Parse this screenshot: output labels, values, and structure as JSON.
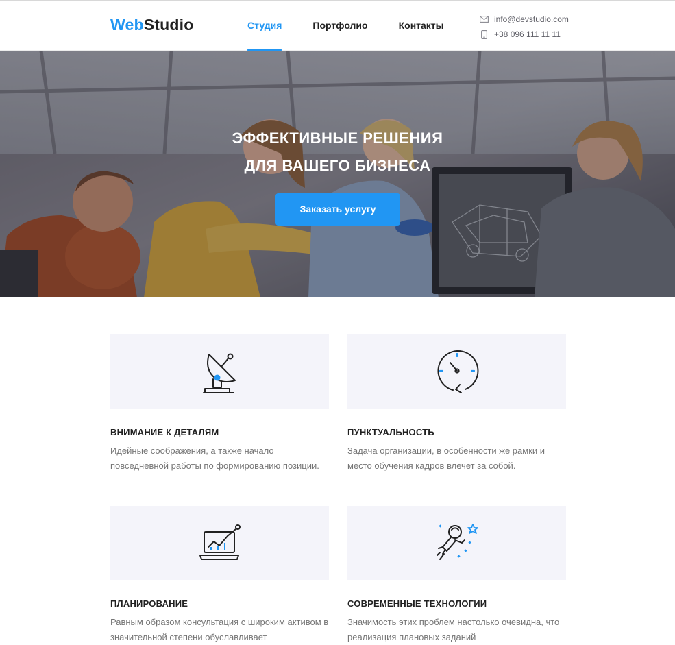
{
  "header": {
    "logo_part1": "Web",
    "logo_part2": "Studio",
    "nav": [
      {
        "label": "Студия",
        "active": true
      },
      {
        "label": "Портфолио"
      },
      {
        "label": "Контакты"
      }
    ],
    "email": "info@devstudio.com",
    "phone": "+38 096 111 11 11"
  },
  "hero": {
    "title_line1": "ЭФФЕКТИВНЫЕ РЕШЕНИЯ",
    "title_line2": "ДЛЯ ВАШЕГО БИЗНЕСА",
    "button_label": "Заказать услугу"
  },
  "features": [
    {
      "icon": "satellite-dish-icon",
      "title": "ВНИМАНИЕ К ДЕТАЛЯМ",
      "text": "Идейные соображения, а также начало повседневной работы по формированию позиции."
    },
    {
      "icon": "clock-icon",
      "title": "ПУНКТУАЛЬНОСТЬ",
      "text": "Задача организации, в особенности же рамки и место обучения кадров влечет за собой."
    },
    {
      "icon": "laptop-chart-icon",
      "title": "ПЛАНИРОВАНИЕ",
      "text": "Равным образом консультация с широким активом в значительной степени обуславливает"
    },
    {
      "icon": "astronaut-icon",
      "title": "СОВРЕМЕННЫЕ ТЕХНОЛОГИИ",
      "text": "Значимость этих проблем настолько очевидна, что реализация плановых заданий"
    }
  ],
  "colors": {
    "accent": "#2196f3",
    "text_dark": "#212121",
    "text_muted": "#757575",
    "card_bg": "#f4f4fa"
  }
}
